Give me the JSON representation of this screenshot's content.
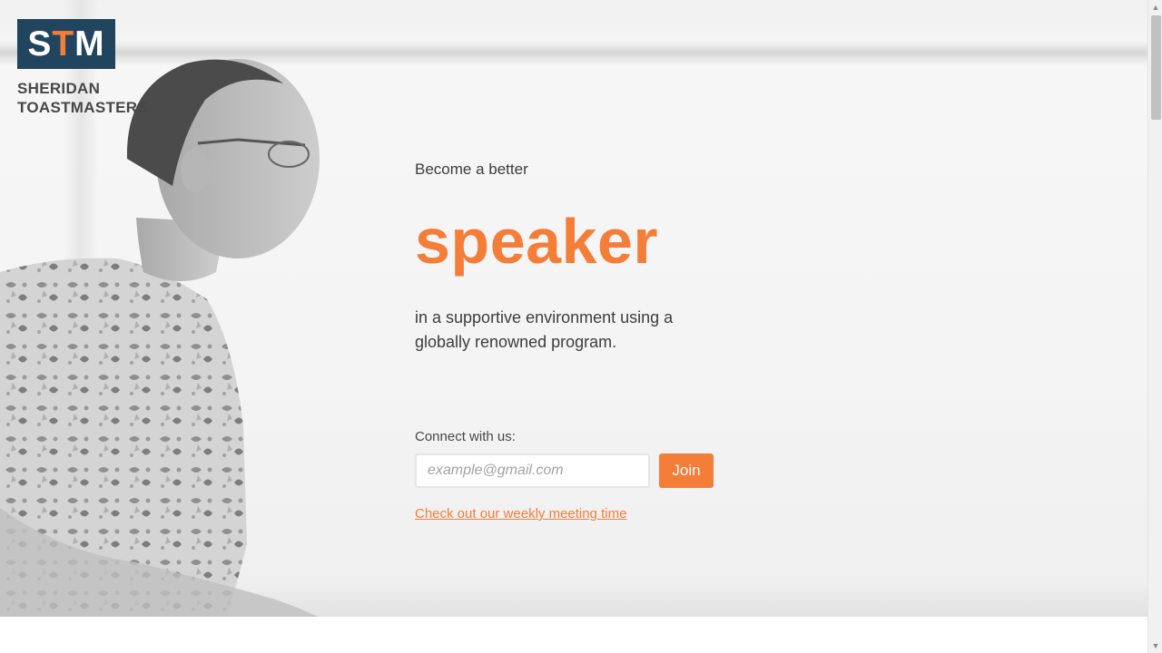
{
  "logo": {
    "abbr_white_1": "S",
    "abbr_orange": "T",
    "abbr_white_2": "M",
    "line1": "SHERIDAN",
    "line2": "TOASTMASTERS"
  },
  "hero": {
    "lead": "Become a better",
    "headline": "speaker",
    "subtitle": "in a supportive environment using a globally renowned program."
  },
  "connect": {
    "label": "Connect with us:",
    "email_placeholder": "example@gmail.com",
    "email_value": "",
    "join_label": "Join",
    "meeting_link": "Check out our weekly meeting time"
  },
  "colors": {
    "accent": "#f47d38",
    "logo_navy": "#21445f",
    "text": "#3d3d3d"
  },
  "icons": {
    "scroll_up": "scroll-up-arrow-icon",
    "scroll_down": "scroll-down-arrow-icon"
  }
}
